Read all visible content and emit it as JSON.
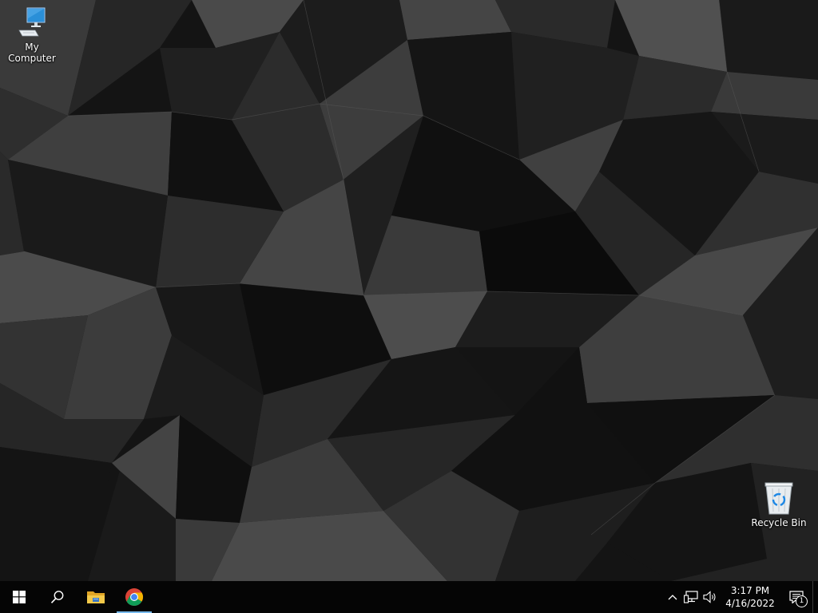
{
  "desktop": {
    "icons": [
      {
        "label": "My Computer",
        "icon": "computer-icon"
      },
      {
        "label": "Recycle Bin",
        "icon": "recycle-bin-icon"
      }
    ]
  },
  "taskbar": {
    "start_icon": "windows-logo-icon",
    "search_icon": "search-icon",
    "pinned": [
      {
        "icon": "file-explorer-icon",
        "active": false
      },
      {
        "icon": "chrome-icon",
        "active": true
      }
    ],
    "tray": {
      "show_hidden_icon": "chevron-up-icon",
      "network_icon": "network-icon",
      "volume_icon": "volume-icon",
      "time": "3:17 PM",
      "date": "4/16/2022",
      "notification_count": "1"
    }
  },
  "colors": {
    "taskbar_bg": "#050505",
    "active_indicator": "#76b9ed",
    "monitor_blue": "#2a8fd8"
  }
}
